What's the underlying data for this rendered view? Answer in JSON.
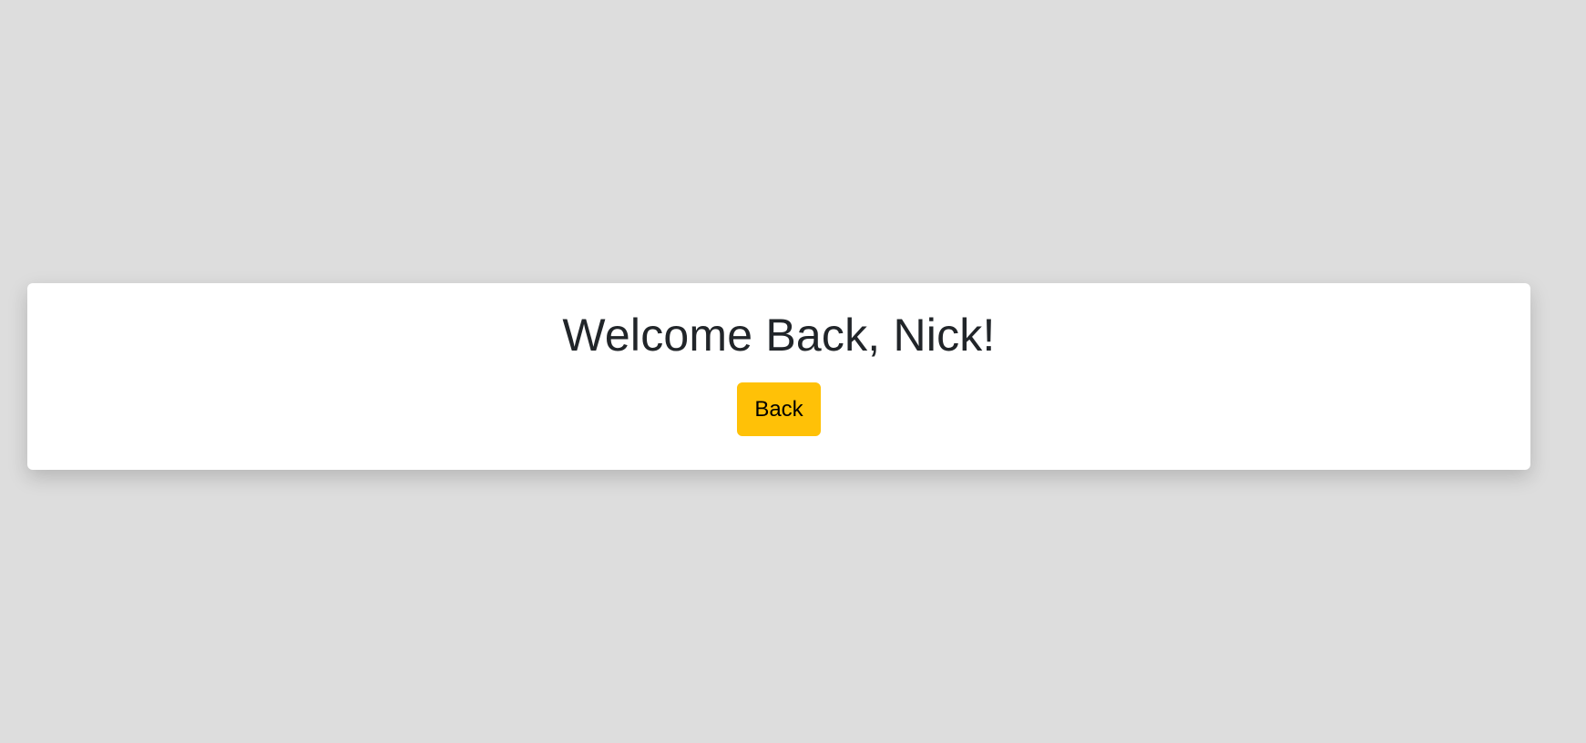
{
  "welcome": {
    "title": "Welcome Back, Nick!",
    "back_label": "Back"
  },
  "colors": {
    "background": "#dddddd",
    "card": "#ffffff",
    "button": "#ffc107",
    "title_text": "#212529"
  }
}
